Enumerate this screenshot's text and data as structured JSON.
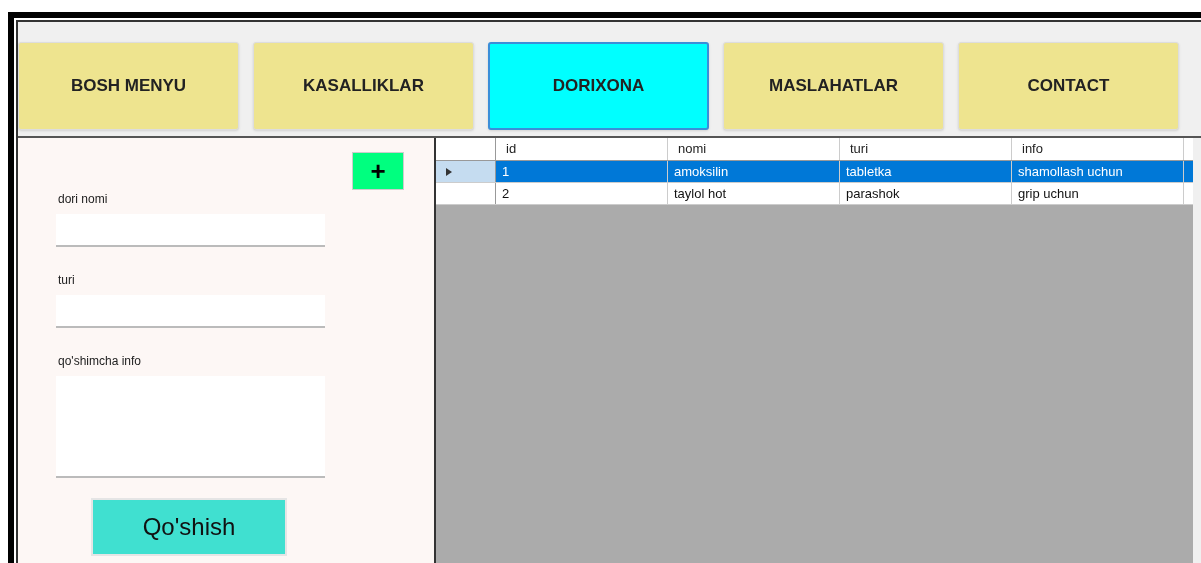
{
  "tabs": [
    {
      "label": "BOSH MENYU",
      "selected": false
    },
    {
      "label": "KASALLIKLAR",
      "selected": false
    },
    {
      "label": "DORIXONA",
      "selected": true
    },
    {
      "label": "MASLAHATLAR",
      "selected": false
    },
    {
      "label": "CONTACT",
      "selected": false
    }
  ],
  "form": {
    "add_icon_button": "+",
    "fields": [
      {
        "label": "dori nomi",
        "kind": "input"
      },
      {
        "label": "turi",
        "kind": "input"
      },
      {
        "label": "qo'shimcha info",
        "kind": "textarea"
      }
    ],
    "submit": "Qo'shish"
  },
  "table": {
    "columns": [
      "id",
      "nomi",
      "turi",
      "info"
    ],
    "rows": [
      {
        "cells": [
          "1",
          "amoksilin",
          "tabletka",
          "shamollash uchun"
        ],
        "selected": true
      },
      {
        "cells": [
          "2",
          "taylol hot",
          "parashok",
          "grip uchun"
        ],
        "selected": false
      }
    ]
  }
}
